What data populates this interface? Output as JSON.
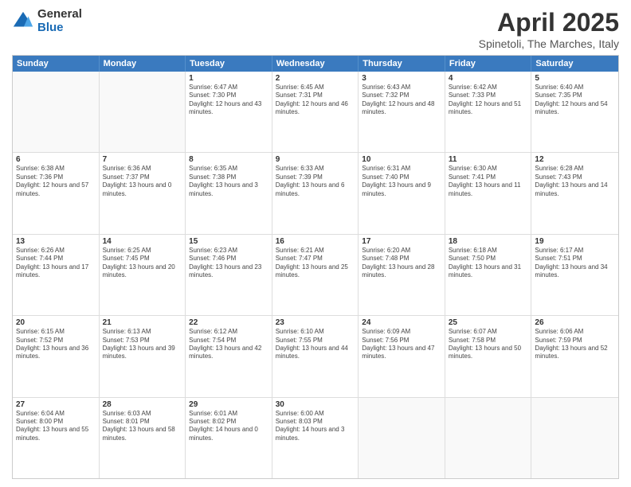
{
  "logo": {
    "general": "General",
    "blue": "Blue"
  },
  "title": "April 2025",
  "subtitle": "Spinetoli, The Marches, Italy",
  "header_days": [
    "Sunday",
    "Monday",
    "Tuesday",
    "Wednesday",
    "Thursday",
    "Friday",
    "Saturday"
  ],
  "weeks": [
    [
      {
        "day": "",
        "sunrise": "",
        "sunset": "",
        "daylight": ""
      },
      {
        "day": "",
        "sunrise": "",
        "sunset": "",
        "daylight": ""
      },
      {
        "day": "1",
        "sunrise": "Sunrise: 6:47 AM",
        "sunset": "Sunset: 7:30 PM",
        "daylight": "Daylight: 12 hours and 43 minutes."
      },
      {
        "day": "2",
        "sunrise": "Sunrise: 6:45 AM",
        "sunset": "Sunset: 7:31 PM",
        "daylight": "Daylight: 12 hours and 46 minutes."
      },
      {
        "day": "3",
        "sunrise": "Sunrise: 6:43 AM",
        "sunset": "Sunset: 7:32 PM",
        "daylight": "Daylight: 12 hours and 48 minutes."
      },
      {
        "day": "4",
        "sunrise": "Sunrise: 6:42 AM",
        "sunset": "Sunset: 7:33 PM",
        "daylight": "Daylight: 12 hours and 51 minutes."
      },
      {
        "day": "5",
        "sunrise": "Sunrise: 6:40 AM",
        "sunset": "Sunset: 7:35 PM",
        "daylight": "Daylight: 12 hours and 54 minutes."
      }
    ],
    [
      {
        "day": "6",
        "sunrise": "Sunrise: 6:38 AM",
        "sunset": "Sunset: 7:36 PM",
        "daylight": "Daylight: 12 hours and 57 minutes."
      },
      {
        "day": "7",
        "sunrise": "Sunrise: 6:36 AM",
        "sunset": "Sunset: 7:37 PM",
        "daylight": "Daylight: 13 hours and 0 minutes."
      },
      {
        "day": "8",
        "sunrise": "Sunrise: 6:35 AM",
        "sunset": "Sunset: 7:38 PM",
        "daylight": "Daylight: 13 hours and 3 minutes."
      },
      {
        "day": "9",
        "sunrise": "Sunrise: 6:33 AM",
        "sunset": "Sunset: 7:39 PM",
        "daylight": "Daylight: 13 hours and 6 minutes."
      },
      {
        "day": "10",
        "sunrise": "Sunrise: 6:31 AM",
        "sunset": "Sunset: 7:40 PM",
        "daylight": "Daylight: 13 hours and 9 minutes."
      },
      {
        "day": "11",
        "sunrise": "Sunrise: 6:30 AM",
        "sunset": "Sunset: 7:41 PM",
        "daylight": "Daylight: 13 hours and 11 minutes."
      },
      {
        "day": "12",
        "sunrise": "Sunrise: 6:28 AM",
        "sunset": "Sunset: 7:43 PM",
        "daylight": "Daylight: 13 hours and 14 minutes."
      }
    ],
    [
      {
        "day": "13",
        "sunrise": "Sunrise: 6:26 AM",
        "sunset": "Sunset: 7:44 PM",
        "daylight": "Daylight: 13 hours and 17 minutes."
      },
      {
        "day": "14",
        "sunrise": "Sunrise: 6:25 AM",
        "sunset": "Sunset: 7:45 PM",
        "daylight": "Daylight: 13 hours and 20 minutes."
      },
      {
        "day": "15",
        "sunrise": "Sunrise: 6:23 AM",
        "sunset": "Sunset: 7:46 PM",
        "daylight": "Daylight: 13 hours and 23 minutes."
      },
      {
        "day": "16",
        "sunrise": "Sunrise: 6:21 AM",
        "sunset": "Sunset: 7:47 PM",
        "daylight": "Daylight: 13 hours and 25 minutes."
      },
      {
        "day": "17",
        "sunrise": "Sunrise: 6:20 AM",
        "sunset": "Sunset: 7:48 PM",
        "daylight": "Daylight: 13 hours and 28 minutes."
      },
      {
        "day": "18",
        "sunrise": "Sunrise: 6:18 AM",
        "sunset": "Sunset: 7:50 PM",
        "daylight": "Daylight: 13 hours and 31 minutes."
      },
      {
        "day": "19",
        "sunrise": "Sunrise: 6:17 AM",
        "sunset": "Sunset: 7:51 PM",
        "daylight": "Daylight: 13 hours and 34 minutes."
      }
    ],
    [
      {
        "day": "20",
        "sunrise": "Sunrise: 6:15 AM",
        "sunset": "Sunset: 7:52 PM",
        "daylight": "Daylight: 13 hours and 36 minutes."
      },
      {
        "day": "21",
        "sunrise": "Sunrise: 6:13 AM",
        "sunset": "Sunset: 7:53 PM",
        "daylight": "Daylight: 13 hours and 39 minutes."
      },
      {
        "day": "22",
        "sunrise": "Sunrise: 6:12 AM",
        "sunset": "Sunset: 7:54 PM",
        "daylight": "Daylight: 13 hours and 42 minutes."
      },
      {
        "day": "23",
        "sunrise": "Sunrise: 6:10 AM",
        "sunset": "Sunset: 7:55 PM",
        "daylight": "Daylight: 13 hours and 44 minutes."
      },
      {
        "day": "24",
        "sunrise": "Sunrise: 6:09 AM",
        "sunset": "Sunset: 7:56 PM",
        "daylight": "Daylight: 13 hours and 47 minutes."
      },
      {
        "day": "25",
        "sunrise": "Sunrise: 6:07 AM",
        "sunset": "Sunset: 7:58 PM",
        "daylight": "Daylight: 13 hours and 50 minutes."
      },
      {
        "day": "26",
        "sunrise": "Sunrise: 6:06 AM",
        "sunset": "Sunset: 7:59 PM",
        "daylight": "Daylight: 13 hours and 52 minutes."
      }
    ],
    [
      {
        "day": "27",
        "sunrise": "Sunrise: 6:04 AM",
        "sunset": "Sunset: 8:00 PM",
        "daylight": "Daylight: 13 hours and 55 minutes."
      },
      {
        "day": "28",
        "sunrise": "Sunrise: 6:03 AM",
        "sunset": "Sunset: 8:01 PM",
        "daylight": "Daylight: 13 hours and 58 minutes."
      },
      {
        "day": "29",
        "sunrise": "Sunrise: 6:01 AM",
        "sunset": "Sunset: 8:02 PM",
        "daylight": "Daylight: 14 hours and 0 minutes."
      },
      {
        "day": "30",
        "sunrise": "Sunrise: 6:00 AM",
        "sunset": "Sunset: 8:03 PM",
        "daylight": "Daylight: 14 hours and 3 minutes."
      },
      {
        "day": "",
        "sunrise": "",
        "sunset": "",
        "daylight": ""
      },
      {
        "day": "",
        "sunrise": "",
        "sunset": "",
        "daylight": ""
      },
      {
        "day": "",
        "sunrise": "",
        "sunset": "",
        "daylight": ""
      }
    ]
  ]
}
